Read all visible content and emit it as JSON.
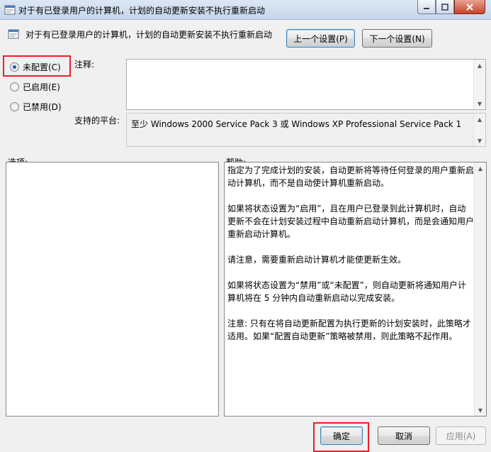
{
  "window": {
    "title": "对于有已登录用户的计算机，计划的自动更新安装不执行重新启动"
  },
  "header": {
    "policy_name": "对于有已登录用户的计算机，计划的自动更新安装不执行重新启动",
    "prev_button": "上一个设置(P)",
    "next_button": "下一个设置(N)"
  },
  "state_options": [
    {
      "label": "未配置(C)",
      "checked": true
    },
    {
      "label": "已启用(E)",
      "checked": false
    },
    {
      "label": "已禁用(D)",
      "checked": false
    }
  ],
  "comment": {
    "label": "注释:",
    "value": ""
  },
  "platform": {
    "label": "支持的平台:",
    "value": "至少 Windows 2000 Service Pack 3 或 Windows XP Professional Service Pack 1"
  },
  "options": {
    "label": "选项:"
  },
  "help": {
    "label": "帮助:",
    "paragraphs": [
      "指定为了完成计划的安装，自动更新将等待任何登录的用户重新启动计算机，而不是自动使计算机重新启动。",
      "如果将状态设置为“启用”，且在用户已登录到此计算机时，自动更新不会在计划安装过程中自动重新启动计算机，而是会通知用户重新启动计算机。",
      "请注意，需要重新启动计算机才能使更新生效。",
      "如果将状态设置为“禁用”或“未配置”，则自动更新将通知用户计算机将在 5 分钟内自动重新启动以完成安装。",
      "注意: 只有在将自动更新配置为执行更新的计划安装时，此策略才适用。如果“配置自动更新”策略被禁用，则此策略不起作用。"
    ]
  },
  "footer": {
    "ok": "确定",
    "cancel": "取消",
    "apply": "应用(A)"
  },
  "colors": {
    "highlight": "#e8202a",
    "titlebar": "#c5d6ea"
  }
}
